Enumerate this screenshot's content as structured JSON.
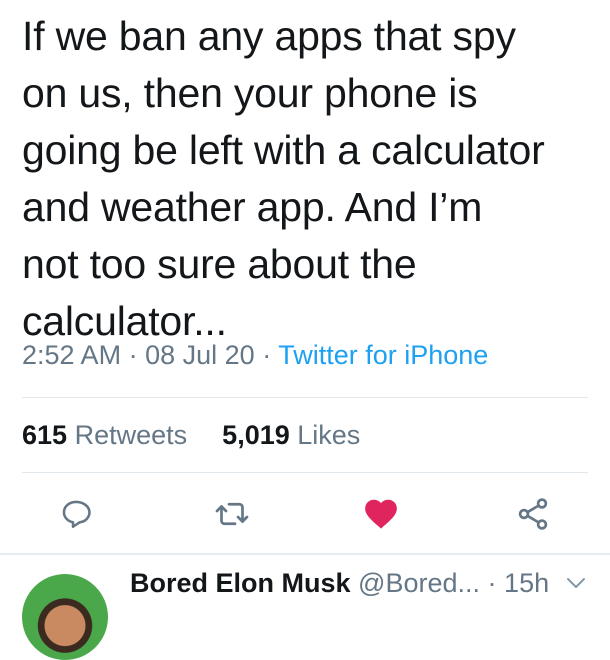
{
  "tweet": {
    "lines": [
      "If we ban any apps that spy",
      "on us, then your phone is",
      "going be left with a calculator",
      "and weather app. And I’m",
      "not too sure about the",
      "calculator..."
    ],
    "time": "2:52 AM",
    "date": "08 Jul 20",
    "separator": "·",
    "source": "Twitter for iPhone"
  },
  "stats": {
    "retweets_count": "615",
    "retweets_label": "Retweets",
    "likes_count": "5,019",
    "likes_label": "Likes"
  },
  "actions": {
    "reply_icon": "reply-icon",
    "retweet_icon": "retweet-icon",
    "like_icon": "heart-icon",
    "share_icon": "share-icon",
    "like_color": "#e0245e",
    "icon_color": "#657786",
    "liked": true
  },
  "reply": {
    "name": "Bored Elon Musk",
    "handle": "@Bored...",
    "separator": "·",
    "time": "15h"
  },
  "colors": {
    "link": "#1da1f2",
    "secondary": "#657786",
    "text": "#14171a"
  }
}
